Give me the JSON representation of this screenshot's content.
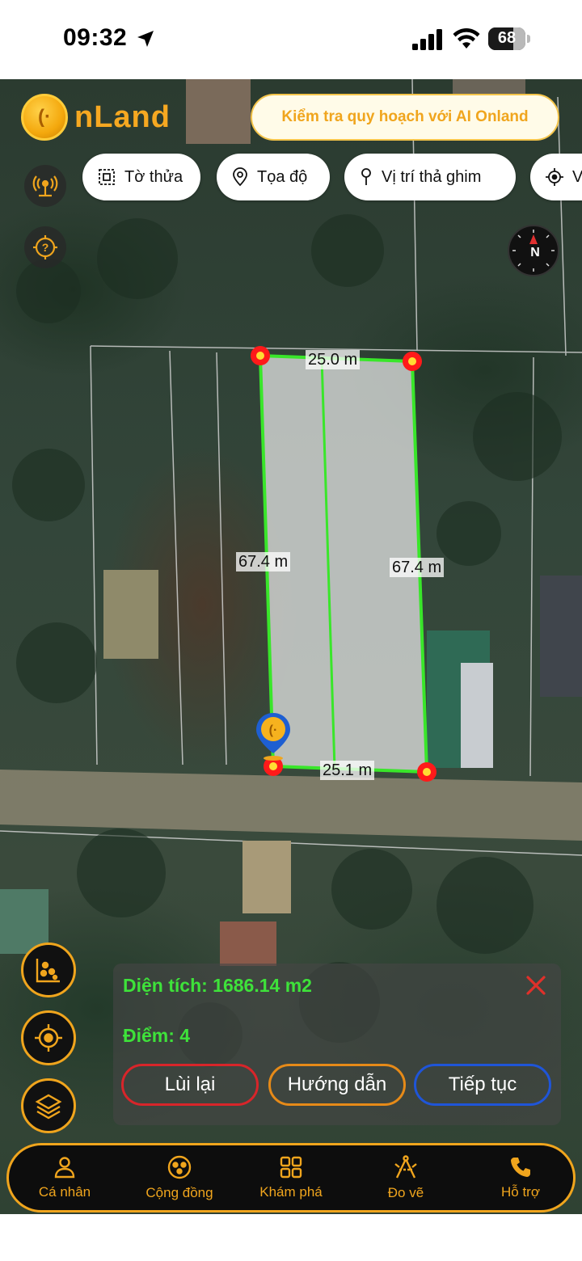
{
  "status_bar": {
    "time": "09:32",
    "battery": "68",
    "battery_level_percent": 68
  },
  "header": {
    "logo_text": "nLand",
    "ai_button_label": "Kiểm tra quy hoạch với AI Onland"
  },
  "chips": [
    {
      "label": "Tờ thửa",
      "icon": "parcel-map-icon"
    },
    {
      "label": "Tọa độ",
      "icon": "location-pin-icon"
    },
    {
      "label": "Vị trí thả ghim",
      "icon": "drop-pin-icon"
    },
    {
      "label": "V",
      "icon": "crosshair-icon"
    }
  ],
  "compass": {
    "label": "N"
  },
  "map": {
    "dimensions": {
      "top": "25.0 m",
      "left": "67.4 m",
      "right": "67.4 m",
      "bottom": "25.1 m"
    },
    "outline_color": "#39e62a",
    "vertex_color": "#ff1a1a"
  },
  "panel": {
    "area": "Diện tích: 1686.14 m2",
    "points": "Điểm: 4",
    "buttons": [
      {
        "label": "Lùi lại",
        "color": "#d8252a"
      },
      {
        "label": "Hướng dẫn",
        "color": "#e68a18"
      },
      {
        "label": "Tiếp tục",
        "color": "#1f55d8"
      }
    ]
  },
  "bottom_nav": [
    {
      "label": "Cá nhân",
      "icon": "person-icon"
    },
    {
      "label": "Cộng đồng",
      "icon": "community-icon"
    },
    {
      "label": "Khám phá",
      "icon": "grid-icon"
    },
    {
      "label": "Đo vẽ",
      "icon": "measure-icon"
    },
    {
      "label": "Hỗ trợ",
      "icon": "phone-icon"
    }
  ],
  "colors": {
    "accent": "#f0a51d",
    "panel_text": "#3ee23a"
  }
}
